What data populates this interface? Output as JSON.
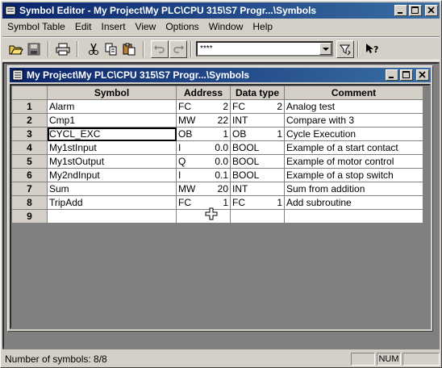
{
  "app": {
    "title": "Symbol Editor - My Project\\My PLC\\CPU 315\\S7 Progr...\\Symbols"
  },
  "menu": [
    "Symbol Table",
    "Edit",
    "Insert",
    "View",
    "Options",
    "Window",
    "Help"
  ],
  "toolbar": {
    "filter_value": "****",
    "icons": [
      "open-icon",
      "save-icon",
      "print-icon",
      "cut-icon",
      "copy-icon",
      "paste-icon",
      "undo-icon",
      "redo-icon",
      "filter-icon",
      "context-help-icon"
    ]
  },
  "child_window": {
    "title": "My Project\\My PLC\\CPU 315\\S7 Progr...\\Symbols"
  },
  "table": {
    "headers": [
      "Symbol",
      "Address",
      "Data type",
      "Comment"
    ],
    "rows": [
      {
        "num": "1",
        "symbol": "Alarm",
        "addr_type": "FC",
        "addr_num": "2",
        "dtype": "FC",
        "dtype_num": "2",
        "comment": "Analog test"
      },
      {
        "num": "2",
        "symbol": "Cmp1",
        "addr_type": "MW",
        "addr_num": "22",
        "dtype": "INT",
        "dtype_num": "",
        "comment": "Compare with 3"
      },
      {
        "num": "3",
        "symbol": "CYCL_EXC",
        "addr_type": "OB",
        "addr_num": "1",
        "dtype": "OB",
        "dtype_num": "1",
        "comment": "Cycle Execution"
      },
      {
        "num": "4",
        "symbol": "My1stInput",
        "addr_type": "I",
        "addr_num": "0.0",
        "dtype": "BOOL",
        "dtype_num": "",
        "comment": "Example of a start contact"
      },
      {
        "num": "5",
        "symbol": "My1stOutput",
        "addr_type": "Q",
        "addr_num": "0.0",
        "dtype": "BOOL",
        "dtype_num": "",
        "comment": "Example of motor control"
      },
      {
        "num": "6",
        "symbol": "My2ndInput",
        "addr_type": "I",
        "addr_num": "0.1",
        "dtype": "BOOL",
        "dtype_num": "",
        "comment": "Example of a stop switch"
      },
      {
        "num": "7",
        "symbol": "Sum",
        "addr_type": "MW",
        "addr_num": "20",
        "dtype": "INT",
        "dtype_num": "",
        "comment": "Sum from addition"
      },
      {
        "num": "8",
        "symbol": "TripAdd",
        "addr_type": "FC",
        "addr_num": "1",
        "dtype": "FC",
        "dtype_num": "1",
        "comment": "Add subroutine"
      },
      {
        "num": "9",
        "symbol": "",
        "addr_type": "",
        "addr_num": "",
        "dtype": "",
        "dtype_num": "",
        "comment": ""
      }
    ]
  },
  "status": {
    "text": "Number of symbols: 8/8",
    "num_indicator": "NUM"
  }
}
